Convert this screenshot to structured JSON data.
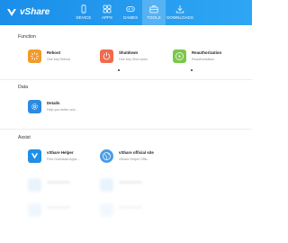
{
  "app": {
    "name": "vShare",
    "colors": {
      "topbar": "#1a8ee9",
      "accent": "#2fa6f4",
      "orange": "#f29a2b",
      "red": "#f06a4d",
      "green": "#7bc84a",
      "blue": "#2b8ae2"
    }
  },
  "nav": {
    "items": [
      {
        "label": "DEVICE",
        "icon": "device-icon"
      },
      {
        "label": "APPS",
        "icon": "apps-icon"
      },
      {
        "label": "GAMES",
        "icon": "games-icon"
      },
      {
        "label": "TOOLS",
        "icon": "tools-icon",
        "active": true
      },
      {
        "label": "DOWNLOADS",
        "icon": "downloads-icon"
      }
    ]
  },
  "sections": {
    "function": {
      "title": "Function",
      "tiles": [
        {
          "title": "Reboot",
          "subtitle": "One key Reboot",
          "icon": "reboot-icon"
        },
        {
          "title": "Shutdown",
          "subtitle": "One Key Shut down",
          "icon": "power-icon"
        },
        {
          "title": "Reauthorization",
          "subtitle": "Reauthorization",
          "icon": "bolt-icon"
        }
      ]
    },
    "data": {
      "title": "Data",
      "tiles": [
        {
          "title": "Details",
          "subtitle": "Help you better und...",
          "icon": "gear-icon"
        }
      ]
    },
    "assist": {
      "title": "Assist",
      "tiles": [
        {
          "title": "vShare Helper",
          "subtitle": "Free Download Apps ...",
          "icon": "vshare-helper-icon"
        },
        {
          "title": "vShare official site",
          "subtitle": "vShare Helper Offic...",
          "icon": "globe-icon"
        }
      ]
    }
  }
}
